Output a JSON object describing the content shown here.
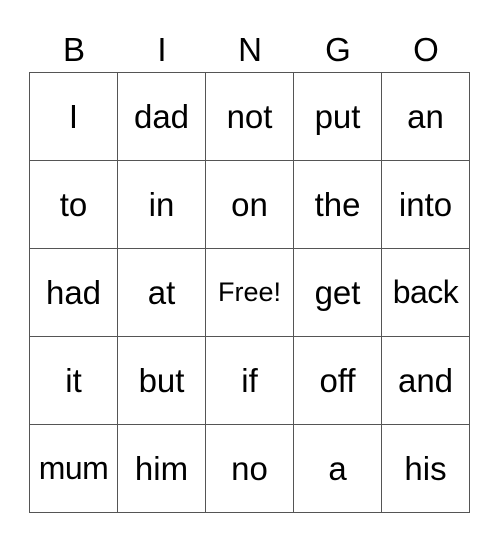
{
  "header": [
    "B",
    "I",
    "N",
    "G",
    "O"
  ],
  "rows": [
    [
      "I",
      "dad",
      "not",
      "put",
      "an"
    ],
    [
      "to",
      "in",
      "on",
      "the",
      "into"
    ],
    [
      "had",
      "at",
      "Free!",
      "get",
      "back"
    ],
    [
      "it",
      "but",
      "if",
      "off",
      "and"
    ],
    [
      "mum",
      "him",
      "no",
      "a",
      "his"
    ]
  ]
}
